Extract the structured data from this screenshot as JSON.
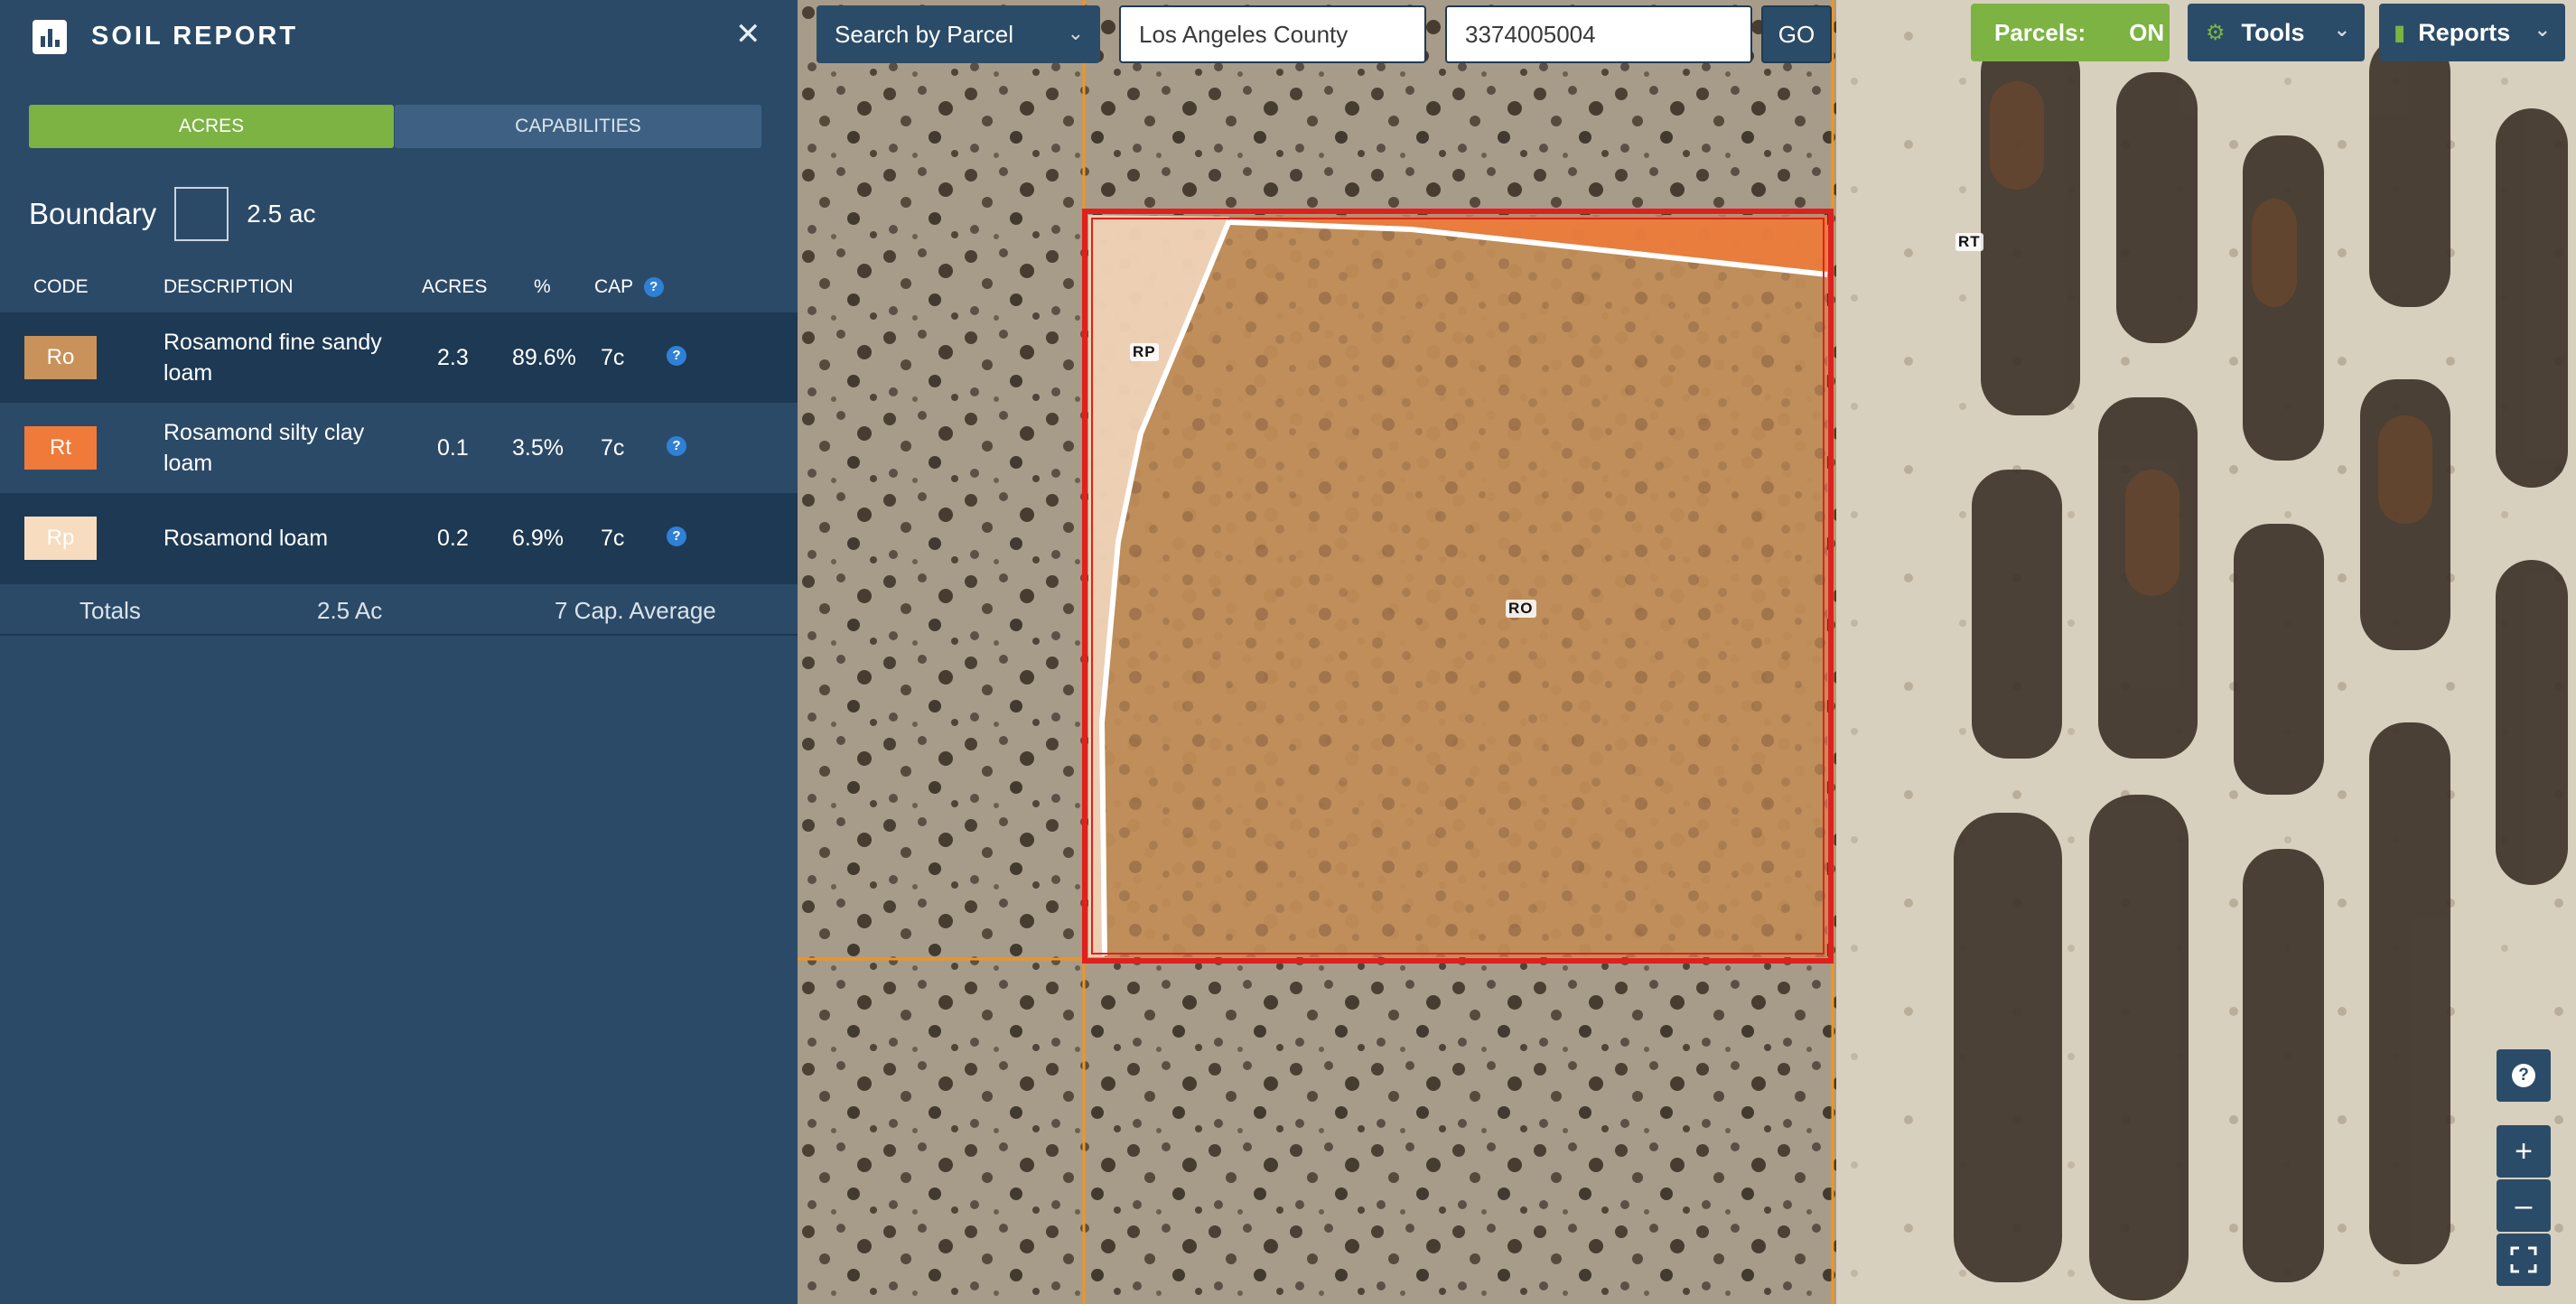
{
  "panel": {
    "title": "SOIL REPORT",
    "tabs": [
      {
        "label": "ACRES",
        "active": true
      },
      {
        "label": "CAPABILITIES",
        "active": false
      }
    ],
    "boundary": {
      "label": "Boundary",
      "value": "2.5 ac"
    },
    "columns": {
      "code": "CODE",
      "description": "DESCRIPTION",
      "acres": "ACRES",
      "percent": "%",
      "cap": "CAP"
    },
    "rows": [
      {
        "code": "Ro",
        "swatch_color": "#c9925b",
        "text_color": "#ffffff",
        "description": "Rosamond fine sandy loam",
        "acres": "2.3",
        "percent": "89.6%",
        "cap": "7c",
        "bg": "#1d3953"
      },
      {
        "code": "Rt",
        "swatch_color": "#f07a3a",
        "text_color": "#ffffff",
        "description": "Rosamond silty clay loam",
        "acres": "0.1",
        "percent": "3.5%",
        "cap": "7c",
        "bg": "#2b4a68"
      },
      {
        "code": "Rp",
        "swatch_color": "#f7dcc0",
        "text_color": "#ffffff",
        "description": "Rosamond loam",
        "acres": "0.2",
        "percent": "6.9%",
        "cap": "7c",
        "bg": "#1d3953"
      }
    ],
    "totals": {
      "label": "Totals",
      "acres": "2.5 Ac",
      "cap": "7 Cap. Average"
    }
  },
  "toolbar": {
    "search_mode": "Search by Parcel",
    "county": "Los Angeles County",
    "parcel_number": "3374005004",
    "go_label": "GO",
    "parcels_label": "Parcels:",
    "parcels_state": "ON",
    "tools_label": "Tools",
    "reports_label": "Reports"
  },
  "map": {
    "soil_labels": {
      "ro": "RO",
      "rt": "RT",
      "rp": "RP"
    },
    "controls": [
      "help",
      "zoom-in",
      "zoom-out",
      "fullscreen"
    ]
  },
  "colors": {
    "panel_bg": "#2b4a68",
    "accent_green": "#7cb342",
    "boundary_red": "#e0201c",
    "parcel_line_orange": "#f5941d"
  }
}
